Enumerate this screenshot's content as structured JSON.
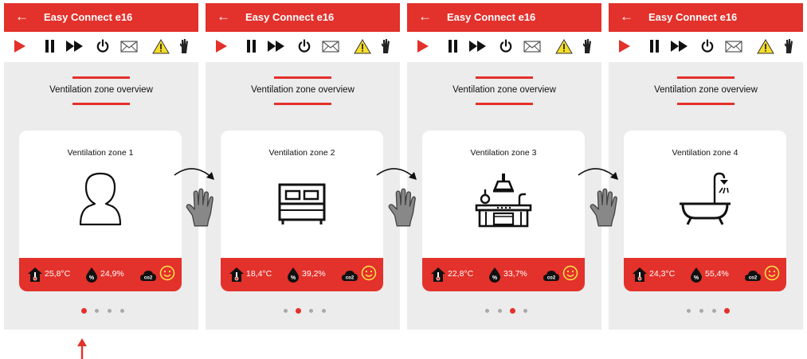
{
  "app": {
    "title": "Easy Connect e16"
  },
  "colors": {
    "brand": "#e3312b",
    "panel": "#ececec",
    "inactive_dot": "#a9a9a9"
  },
  "toolbar_icons": [
    "play-icon",
    "pause-icon",
    "fast-forward-icon",
    "power-icon",
    "mail-icon",
    "warning-icon",
    "hand-icon"
  ],
  "section_title": "Ventilation zone overview",
  "screens": [
    {
      "zone": "Ventilation zone 1",
      "icon": "person-icon",
      "temperature": "25,8°C",
      "humidity": "24,9%",
      "page_index": 0
    },
    {
      "zone": "Ventilation zone 2",
      "icon": "bed-icon",
      "temperature": "18,4°C",
      "humidity": "39,2%",
      "page_index": 1
    },
    {
      "zone": "Ventilation zone 3",
      "icon": "kitchen-icon",
      "temperature": "22,8°C",
      "humidity": "33,7%",
      "page_index": 2
    },
    {
      "zone": "Ventilation zone 4",
      "icon": "bathtub-icon",
      "temperature": "24,3°C",
      "humidity": "55,4%",
      "page_index": 3
    }
  ],
  "status_icons": {
    "temperature": "thermometer-house-icon",
    "humidity": "humidity-drop-icon",
    "co2": "co2-cloud-icon",
    "air_quality": "smiley-icon"
  },
  "co2_label": "co2",
  "page_count": 4,
  "annotations": [
    "swipe-gesture",
    "swipe-gesture",
    "swipe-gesture",
    "pointer-arrow"
  ]
}
